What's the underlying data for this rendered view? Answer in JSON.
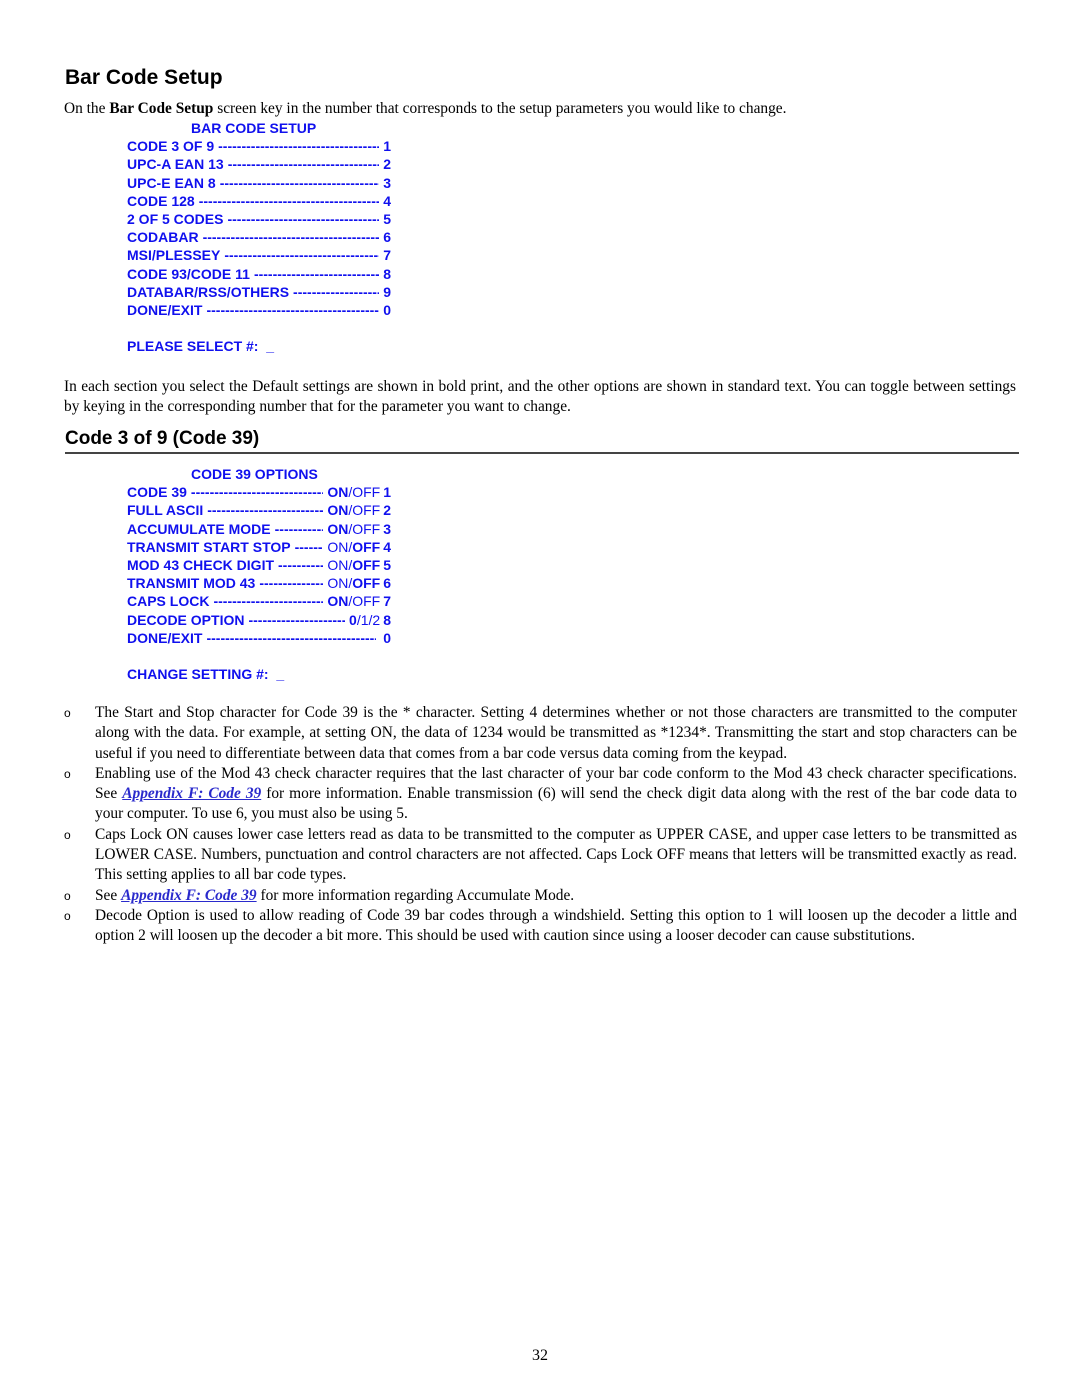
{
  "heading": "Bar Code Setup",
  "intro": {
    "pre": "On the ",
    "bold": "Bar Code Setup",
    "post": " screen key in the number that corresponds to the setup parameters you would like to change."
  },
  "bar_code_menu": {
    "title": "BAR CODE SETUP",
    "items": [
      {
        "label": "CODE 3 OF 9",
        "key": "1"
      },
      {
        "label": "UPC-A EAN 13",
        "key": "2"
      },
      {
        "label": "UPC-E EAN 8",
        "key": "3"
      },
      {
        "label": "CODE 128",
        "key": "4"
      },
      {
        "label": "2 OF 5 CODES",
        "key": "5"
      },
      {
        "label": "CODABAR",
        "key": "6"
      },
      {
        "label": "MSI/PLESSEY",
        "key": "7"
      },
      {
        "label": "CODE 93/CODE 11",
        "key": "8"
      },
      {
        "label": "DATABAR/RSS/OTHERS",
        "key": "9"
      },
      {
        "label": "DONE/EXIT",
        "key": "0"
      }
    ],
    "prompt": "PLEASE SELECT #:  _"
  },
  "defaults_note": "In each section you select the Default settings are shown in bold print, and the other options are shown in standard text.  You can toggle between settings by keying in the corresponding number that for the parameter you want to change.",
  "section_heading": "Code 3 of 9 (Code 39)",
  "code39_menu": {
    "title": "CODE 39 OPTIONS",
    "items": [
      {
        "label": "CODE 39",
        "options": [
          "ON",
          "OFF"
        ],
        "default": "ON",
        "key": "1"
      },
      {
        "label": "FULL ASCII",
        "options": [
          "ON",
          "OFF"
        ],
        "default": "ON",
        "key": "2"
      },
      {
        "label": "ACCUMULATE MODE",
        "options": [
          "ON",
          "OFF"
        ],
        "default": "ON",
        "key": "3"
      },
      {
        "label": "TRANSMIT START STOP",
        "options": [
          "ON",
          "OFF"
        ],
        "default": "OFF",
        "key": "4"
      },
      {
        "label": "MOD 43 CHECK DIGIT",
        "options": [
          "ON",
          "OFF"
        ],
        "default": "OFF",
        "key": "5"
      },
      {
        "label": "TRANSMIT MOD 43",
        "options": [
          "ON",
          "OFF"
        ],
        "default": "OFF",
        "key": "6"
      },
      {
        "label": "CAPS LOCK",
        "options": [
          "ON",
          "OFF"
        ],
        "default": "ON",
        "key": "7"
      },
      {
        "label": "DECODE OPTION",
        "options": [
          "0",
          "1",
          "2"
        ],
        "default": "0",
        "key": "8"
      },
      {
        "label": "DONE/EXIT",
        "options": [],
        "default": "",
        "key": "0"
      }
    ],
    "prompt": "CHANGE SETTING #:  _"
  },
  "bullets": [
    {
      "text": "The Start and Stop character for Code 39 is the * character.  Setting 4 determines whether or not those characters are transmitted to the computer along with the data.  For example, at setting ON, the data of 1234 would be transmitted as *1234*.  Transmitting the start and stop characters can be useful if you need to differentiate between data that comes from a bar code versus data coming from the keypad."
    },
    {
      "pre": "Enabling use of the Mod 43 check character requires that the last character of your bar code conform to the Mod 43 check character specifications.  See ",
      "link": "Appendix F: Code 39",
      "post": " for more information. Enable transmission (6) will send the check digit data along with the rest of the bar code data to your computer.  To use 6, you must also be using 5."
    },
    {
      "text": "Caps Lock ON causes lower case letters read as data to be transmitted to the computer as UPPER CASE, and upper case letters to be transmitted as LOWER CASE.  Numbers, punctuation and control characters are not affected.  Caps Lock OFF means that letters will be transmitted exactly as read. This setting applies to all bar code types."
    },
    {
      "pre": "See ",
      "link": "Appendix F: Code 39",
      "post": " for more information regarding Accumulate Mode."
    },
    {
      "text": "Decode Option is used to allow reading of Code 39 bar codes through a windshield.  Setting this option to 1 will loosen up the decoder a little and option 2 will loosen up the decoder a bit more.  This should be used with caution since using a looser decoder can cause substitutions."
    }
  ],
  "bullet_glyph": "o",
  "page_number": "32",
  "colors": {
    "menu_text": "#1010ee",
    "link": "#2a2acc"
  }
}
